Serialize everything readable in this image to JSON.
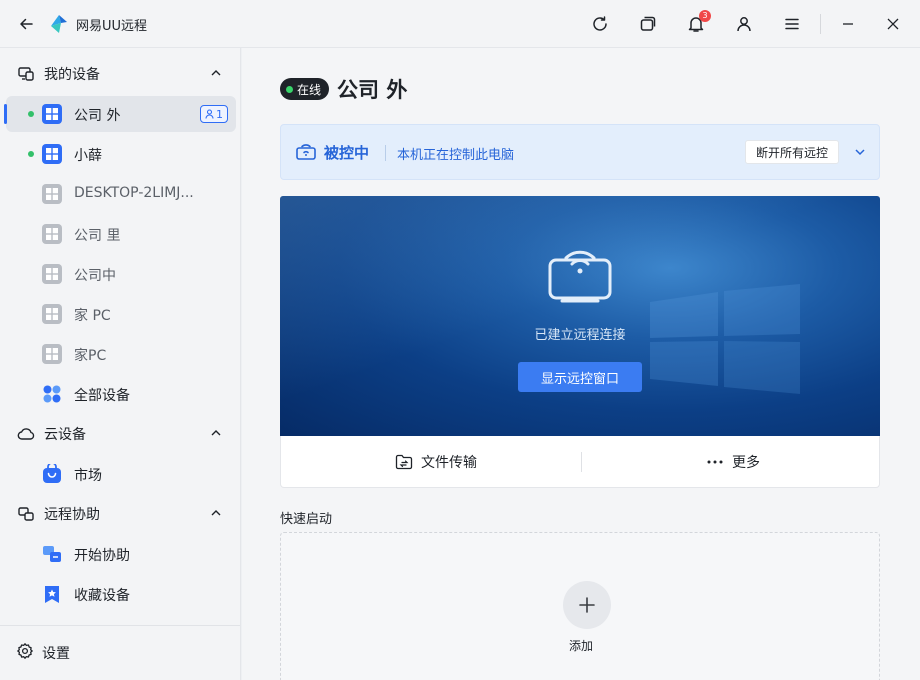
{
  "titlebar": {
    "title": "网易UU远程",
    "notification_count": "3"
  },
  "sidebar": {
    "groups": {
      "my_devices": "我的设备",
      "cloud": "云设备",
      "assist": "远程协助"
    },
    "devices": [
      {
        "label": "公司 外",
        "online": true,
        "active": true,
        "count": "1"
      },
      {
        "label": "小薛",
        "online": true
      },
      {
        "label": "DESKTOP-2LIMJ...",
        "online": false
      },
      {
        "label": "公司 里",
        "online": false
      },
      {
        "label": "公司中",
        "online": false
      },
      {
        "label": "家 PC",
        "online": false
      },
      {
        "label": "家PC",
        "online": false
      },
      {
        "label": "全部设备",
        "online": false
      }
    ],
    "cloud_items": [
      {
        "label": "市场"
      }
    ],
    "assist_items": [
      {
        "label": "开始协助"
      },
      {
        "label": "收藏设备"
      }
    ],
    "settings": "设置"
  },
  "main": {
    "status": "在线",
    "device_name": "公司 外",
    "banner": {
      "title": "被控中",
      "desc": "本机正在控制此电脑",
      "button": "断开所有远控"
    },
    "preview": {
      "text": "已建立远程连接",
      "button": "显示远控窗口"
    },
    "actions": {
      "file_transfer": "文件传输",
      "more": "更多"
    },
    "quick": {
      "title": "快速启动",
      "add": "添加"
    }
  },
  "colors": {
    "accent": "#2f6df6",
    "online": "#33c06a",
    "banner_text": "#2765d8"
  }
}
